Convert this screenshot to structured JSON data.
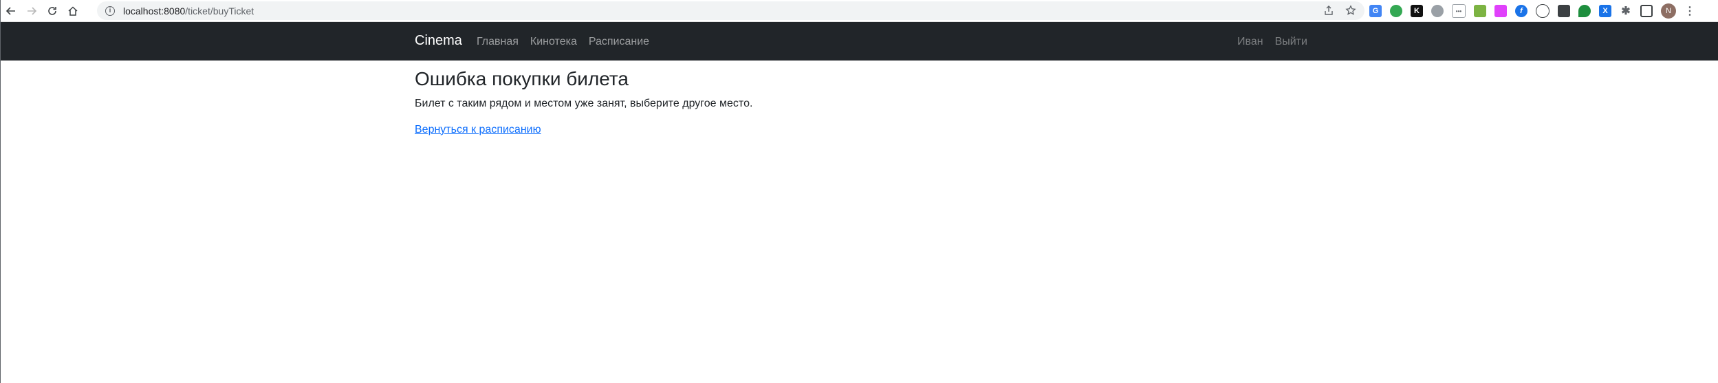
{
  "browser": {
    "url_host": "localhost:8080",
    "url_path": "/ticket/buyTicket",
    "profile_initial": "N"
  },
  "navbar": {
    "brand": "Cinema",
    "links": [
      {
        "label": "Главная"
      },
      {
        "label": "Кинотека"
      },
      {
        "label": "Расписание"
      }
    ],
    "user": "Иван",
    "logout": "Выйти"
  },
  "main": {
    "title": "Ошибка покупки билета",
    "message": "Билет с таким рядом и местом уже занят, выберите другое место.",
    "back_link": "Вернуться к расписанию"
  }
}
